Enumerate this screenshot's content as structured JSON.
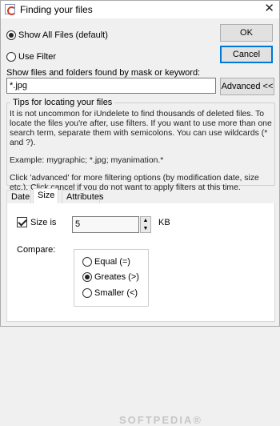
{
  "window": {
    "title": "Finding your files",
    "close_glyph": "✕"
  },
  "buttons": {
    "ok": "OK",
    "cancel": "Cancel",
    "advanced": "Advanced <<"
  },
  "filter_mode": {
    "show_all_label": "Show All Files (default)",
    "use_filter_label": "Use Filter",
    "selected": "show_all"
  },
  "mask": {
    "label": "Show files and folders found by mask or keyword:",
    "value": "*.jpg"
  },
  "tips": {
    "title": "Tips for locating your files",
    "paragraph1": "It is not uncommon for iUndelete to find thousands of deleted files. To locate the files you're after, use filters. If you want to use more than one search term, separate them with semicolons. You can use wildcards (* and ?).",
    "paragraph2": "Example: mygraphic; *.jpg; myanimation.*",
    "paragraph3": "Click 'advanced' for more filtering options (by modification date, size etc.). Click cancel if you do not want to apply filters at this time."
  },
  "tabs": [
    {
      "label": "Date",
      "active": false
    },
    {
      "label": "Size",
      "active": true
    },
    {
      "label": "Attributes",
      "active": false
    }
  ],
  "size_panel": {
    "size_is_label": "Size is",
    "size_is_checked": true,
    "size_value": "5",
    "unit": "KB",
    "compare_label": "Compare:",
    "options": [
      {
        "label": "Equal (=)",
        "checked": false
      },
      {
        "label": "Greates (>)",
        "checked": true
      },
      {
        "label": "Smaller (<)",
        "checked": false
      }
    ]
  },
  "watermark": "SOFTPEDIA®",
  "icons": {
    "app": "app-icon",
    "spin_up": "chevron-up-icon",
    "spin_down": "chevron-down-icon"
  }
}
